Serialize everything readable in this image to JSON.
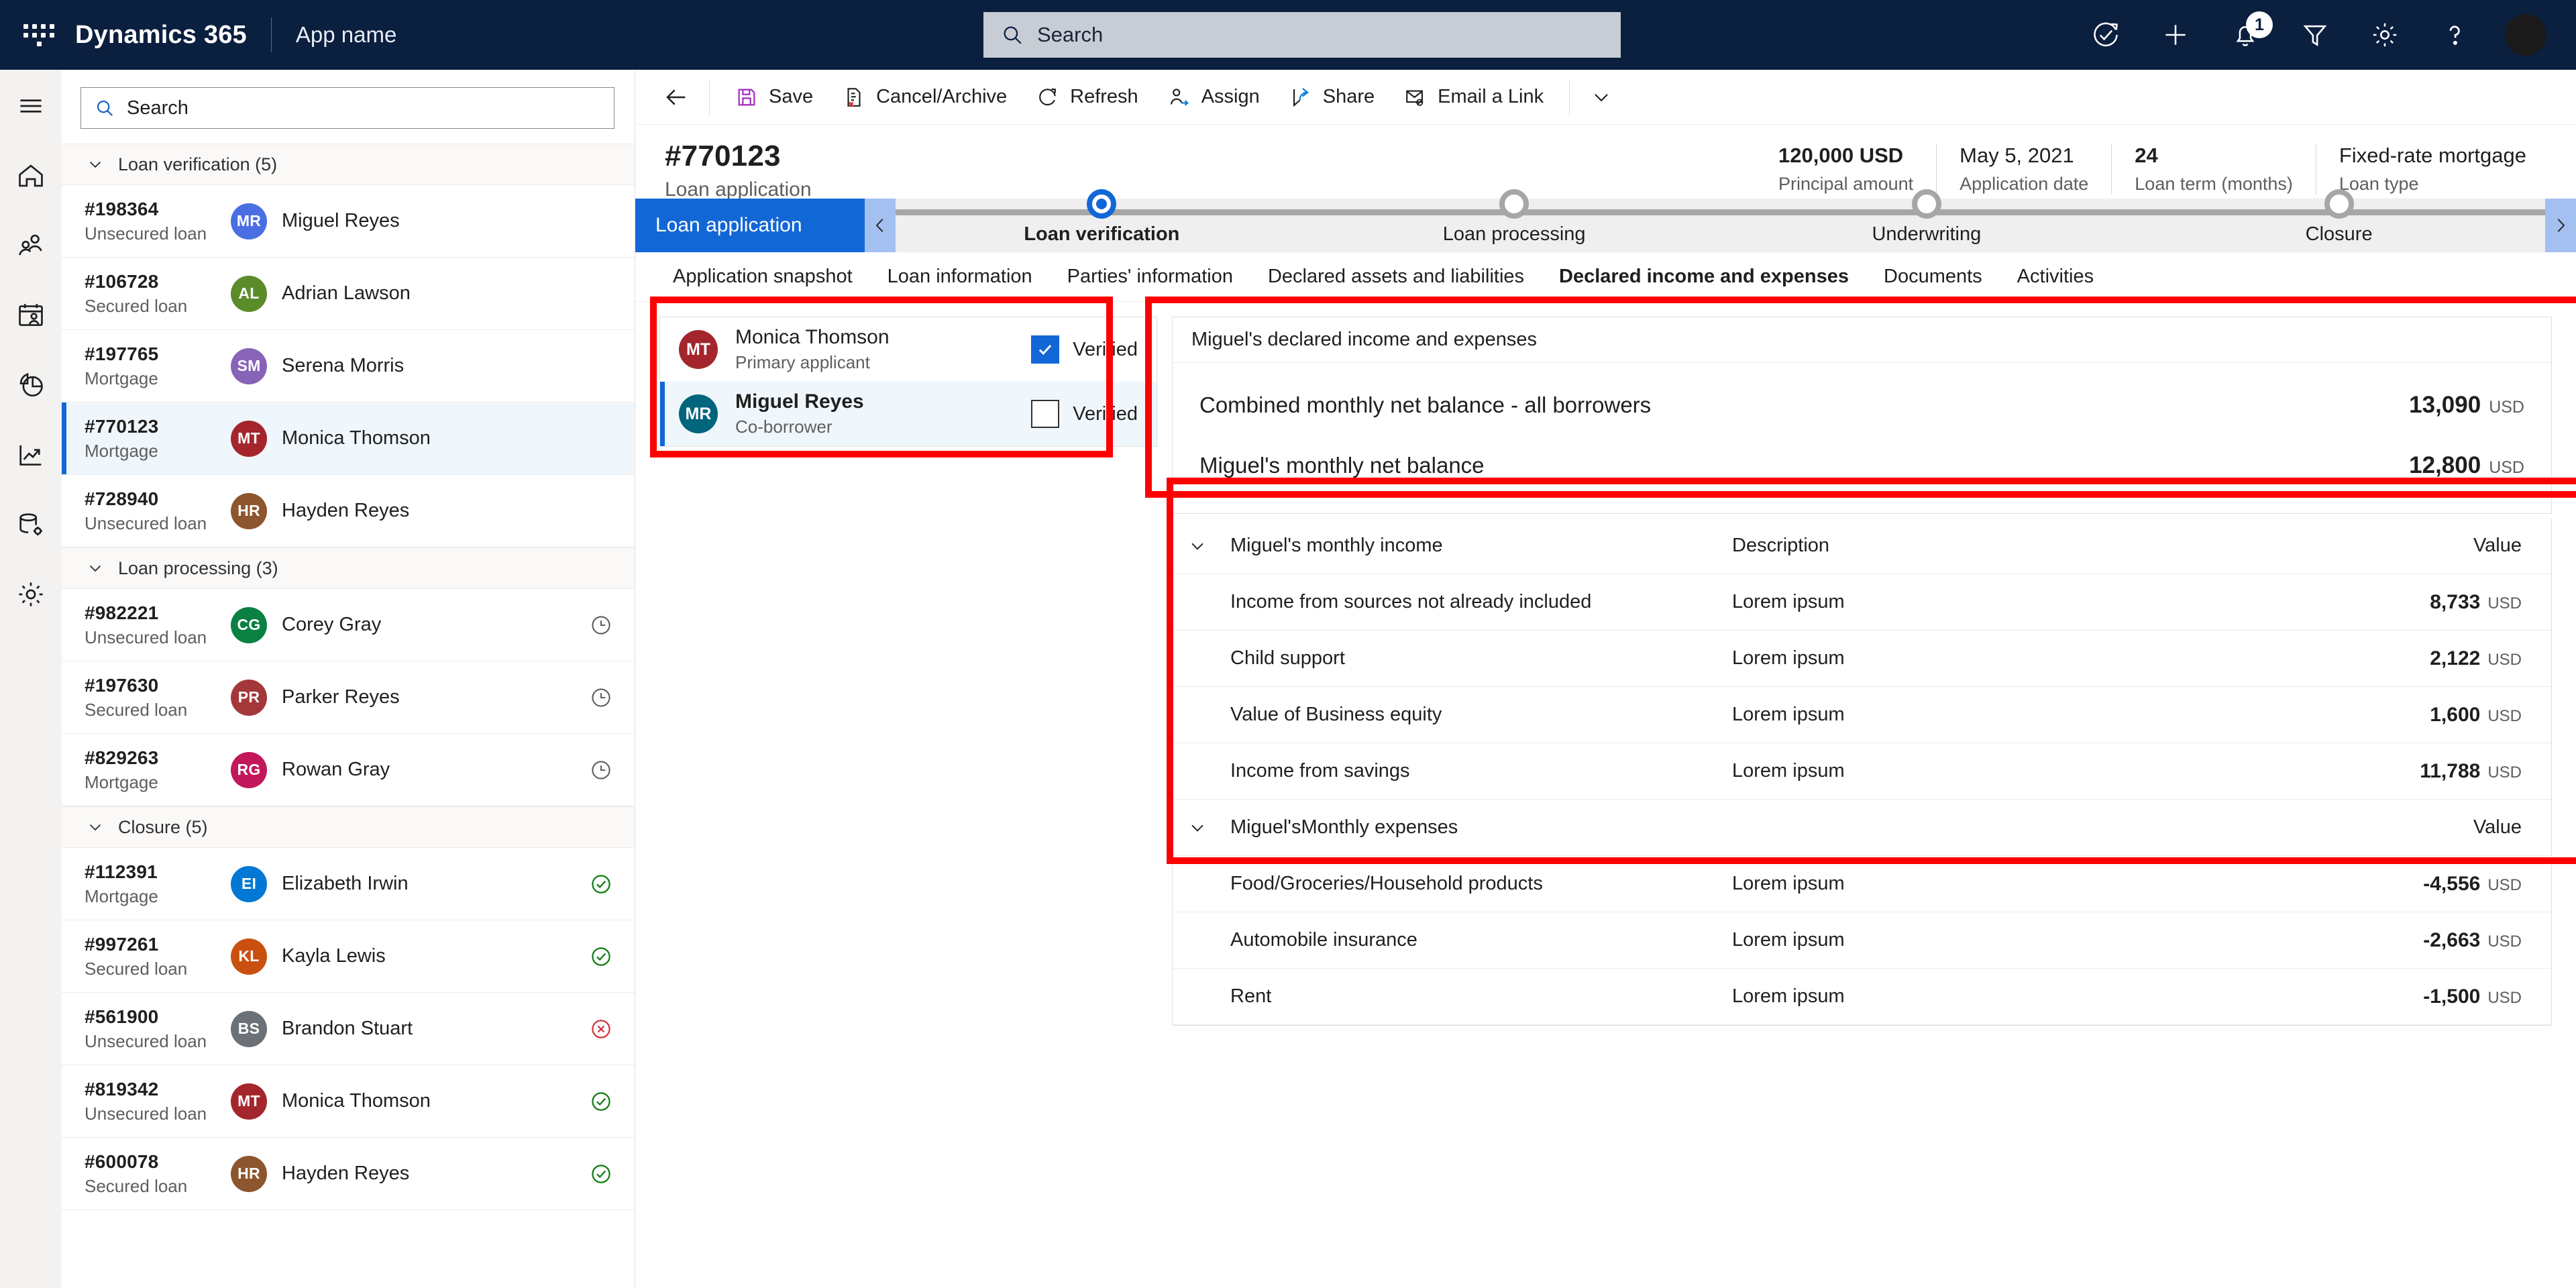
{
  "topnav": {
    "waffle_label": "App launcher",
    "brand": "Dynamics 365",
    "app_name": "App name",
    "search_placeholder": "Search",
    "notification_count": "1",
    "icons": [
      "task-complete-icon",
      "plus-icon",
      "bell-icon",
      "filter-icon",
      "gear-icon",
      "help-icon",
      "avatar"
    ]
  },
  "rail": {
    "items": [
      {
        "name": "hamburger-menu"
      },
      {
        "name": "home"
      },
      {
        "name": "people"
      },
      {
        "name": "calendar-person"
      },
      {
        "name": "pie-chart"
      },
      {
        "name": "trend-chart"
      },
      {
        "name": "database-settings"
      },
      {
        "name": "settings-gear"
      }
    ]
  },
  "list": {
    "search_placeholder": "Search",
    "groups": [
      {
        "label": "Loan verification (5)",
        "rows": [
          {
            "number": "#198364",
            "type": "Unsecured loan",
            "initials": "MR",
            "name": "Miguel Reyes",
            "color": "#4A6FE3",
            "status": ""
          },
          {
            "number": "#106728",
            "type": "Secured loan",
            "initials": "AL",
            "name": "Adrian Lawson",
            "color": "#5B8C2A",
            "status": ""
          },
          {
            "number": "#197765",
            "type": "Mortgage",
            "initials": "SM",
            "name": "Serena Morris",
            "color": "#8764B8",
            "status": ""
          },
          {
            "number": "#770123",
            "type": "Mortgage",
            "initials": "MT",
            "name": "Monica Thomson",
            "color": "#A4262C",
            "status": "",
            "selected": true
          },
          {
            "number": "#728940",
            "type": "Unsecured loan",
            "initials": "HR",
            "name": "Hayden Reyes",
            "color": "#8E562E",
            "status": ""
          }
        ]
      },
      {
        "label": "Loan processing (3)",
        "rows": [
          {
            "number": "#982221",
            "type": "Unsecured loan",
            "initials": "CG",
            "name": "Corey Gray",
            "color": "#0B8043",
            "status": "pending"
          },
          {
            "number": "#197630",
            "type": "Secured loan",
            "initials": "PR",
            "name": "Parker Reyes",
            "color": "#A4373A",
            "status": "pending"
          },
          {
            "number": "#829263",
            "type": "Mortgage",
            "initials": "RG",
            "name": "Rowan Gray",
            "color": "#C2185B",
            "status": "pending"
          }
        ]
      },
      {
        "label": "Closure (5)",
        "rows": [
          {
            "number": "#112391",
            "type": "Mortgage",
            "initials": "EI",
            "name": "Elizabeth Irwin",
            "color": "#0078D4",
            "status": "success"
          },
          {
            "number": "#997261",
            "type": "Secured loan",
            "initials": "KL",
            "name": "Kayla Lewis",
            "color": "#CA5010",
            "status": "success"
          },
          {
            "number": "#561900",
            "type": "Unsecured loan",
            "initials": "BS",
            "name": "Brandon Stuart",
            "color": "#6B7177",
            "status": "error"
          },
          {
            "number": "#819342",
            "type": "Unsecured loan",
            "initials": "MT",
            "name": "Monica Thomson",
            "color": "#A4262C",
            "status": "success"
          },
          {
            "number": "#600078",
            "type": "Secured loan",
            "initials": "HR",
            "name": "Hayden Reyes",
            "color": "#8E562E",
            "status": "success"
          }
        ]
      }
    ]
  },
  "commandbar": {
    "back": "back-arrow",
    "items": [
      {
        "label": "Save",
        "icon": "save-icon"
      },
      {
        "label": "Cancel/Archive",
        "icon": "cancel-archive-icon"
      },
      {
        "label": "Refresh",
        "icon": "refresh-icon"
      },
      {
        "label": "Assign",
        "icon": "assign-icon"
      },
      {
        "label": "Share",
        "icon": "share-icon"
      },
      {
        "label": "Email a Link",
        "icon": "email-link-icon"
      }
    ],
    "overflow": "chevron-down-icon"
  },
  "record": {
    "title": "#770123",
    "subtitle": "Loan application",
    "header_fields": [
      {
        "value": "120,000 USD",
        "label": "Principal amount",
        "bold": true
      },
      {
        "value": "May 5, 2021",
        "label": "Application date",
        "bold": false
      },
      {
        "value": "24",
        "label": "Loan term (months)",
        "bold": true
      },
      {
        "value": "Fixed-rate mortgage",
        "label": "Loan type",
        "bold": false
      }
    ]
  },
  "bpf": {
    "active_stage": "Loan application",
    "prev_chevron": "chevron-left-icon",
    "next_chevron": "chevron-right-icon",
    "stages": [
      {
        "label": "Loan verification",
        "current": true
      },
      {
        "label": "Loan processing",
        "current": false
      },
      {
        "label": "Underwriting",
        "current": false
      },
      {
        "label": "Closure",
        "current": false
      }
    ]
  },
  "tabs": [
    {
      "label": "Application snapshot",
      "active": false
    },
    {
      "label": "Loan information",
      "active": false
    },
    {
      "label": "Parties' information",
      "active": false
    },
    {
      "label": "Declared assets and liabilities",
      "active": false
    },
    {
      "label": "Declared income and expenses",
      "active": true
    },
    {
      "label": "Documents",
      "active": false
    },
    {
      "label": "Activities",
      "active": false
    }
  ],
  "applicants": [
    {
      "initials": "MT",
      "name": "Monica Thomson",
      "role": "Primary applicant",
      "color": "#A4262C",
      "verified_label": "Verified",
      "verified": true,
      "selected": false
    },
    {
      "initials": "MR",
      "name": "Miguel Reyes",
      "role": "Co-borrower",
      "color": "#00657D",
      "verified_label": "Verified",
      "verified": false,
      "selected": true
    }
  ],
  "details": {
    "card_title": "Miguel's declared income and expenses",
    "summary": [
      {
        "label": "Combined monthly net balance - all borrowers",
        "value": "13,090",
        "currency": "USD"
      },
      {
        "label": "Miguel's monthly net balance",
        "value": "12,800",
        "currency": "USD"
      }
    ],
    "income_section": {
      "title": "Miguel's monthly income",
      "desc_header": "Description",
      "value_header": "Value",
      "rows": [
        {
          "name": "Income from sources not already included",
          "description": "Lorem ipsum",
          "value": "8,733",
          "currency": "USD"
        },
        {
          "name": "Child support",
          "description": "Lorem ipsum",
          "value": "2,122",
          "currency": "USD"
        },
        {
          "name": "Value of Business equity",
          "description": "Lorem ipsum",
          "value": "1,600",
          "currency": "USD"
        },
        {
          "name": "Income from savings",
          "description": "Lorem ipsum",
          "value": "11,788",
          "currency": "USD"
        }
      ]
    },
    "expense_section": {
      "title": "Miguel'sMonthly expenses",
      "desc_header": "",
      "value_header": "Value",
      "rows": [
        {
          "name": "Food/Groceries/Household products",
          "description": "Lorem ipsum",
          "value": "-4,556",
          "currency": "USD"
        },
        {
          "name": "Automobile insurance",
          "description": "Lorem ipsum",
          "value": "-2,663",
          "currency": "USD"
        },
        {
          "name": "Rent",
          "description": "Lorem ipsum",
          "value": "-1,500",
          "currency": "USD"
        }
      ]
    }
  },
  "annotations": {
    "highlight_color": "#ff0000",
    "boxes": [
      "applicants-panel",
      "details-panel",
      "income-expense-table"
    ]
  }
}
